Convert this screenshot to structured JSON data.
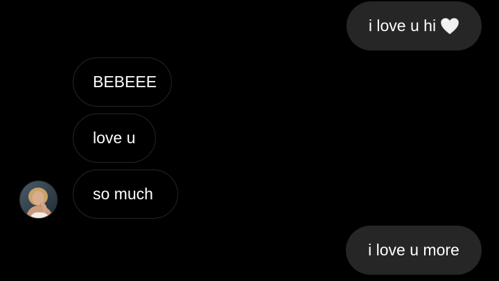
{
  "colors": {
    "background": "#000000",
    "sent_bubble": "#262626",
    "received_border": "#262626",
    "text": "#ffffff"
  },
  "messages": {
    "sent_1": {
      "text": "i love u hi",
      "icon": "white-heart-icon"
    },
    "received": [
      {
        "text": "BEBEEE"
      },
      {
        "text": "love u"
      },
      {
        "text": "so much"
      }
    ],
    "sent_2": {
      "text": "i love u more"
    }
  },
  "avatar": {
    "icon": "contact-avatar"
  }
}
